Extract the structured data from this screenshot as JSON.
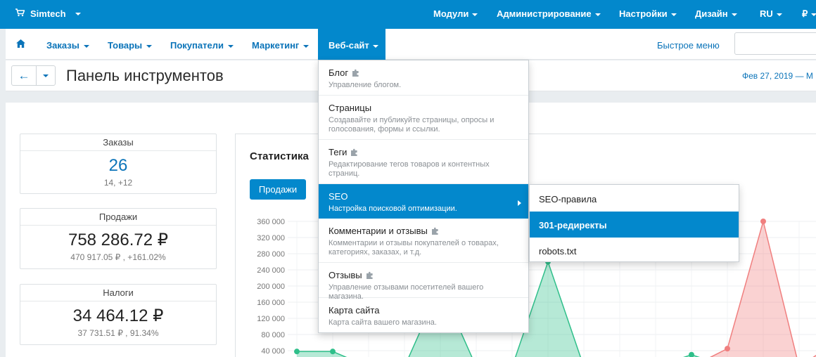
{
  "topbar": {
    "store_name": "Simtech",
    "cart_icon": "cart-icon",
    "menus": [
      "Модули",
      "Администрирование",
      "Настройки",
      "Дизайн",
      "RU",
      "₽"
    ]
  },
  "nav": {
    "home_icon": "home-icon",
    "items": [
      "Заказы",
      "Товары",
      "Покупатели",
      "Маркетинг"
    ],
    "active": "Веб-сайт",
    "quick_menu": "Быстрое меню",
    "search_placeholder": ""
  },
  "page": {
    "title": "Панель инструментов",
    "date_range": "Фев 27, 2019 — М"
  },
  "cards": [
    {
      "label": "Заказы",
      "value": "26",
      "sub": "14, +12"
    },
    {
      "label": "Продажи",
      "value": "758 286.72 ₽",
      "sub": "470 917.05 ₽ , +161.02%"
    },
    {
      "label": "Налоги",
      "value": "34 464.12 ₽",
      "sub": "37 731.51 ₽ , 91.34%"
    }
  ],
  "stats": {
    "title": "Статистика",
    "button": "Продажи"
  },
  "dropdown": {
    "items": [
      {
        "title": "Блог",
        "desc": "Управление блогом.",
        "addon": true
      },
      {
        "title": "Страницы",
        "desc": "Создавайте и публикуйте страницы, опросы и голосования, формы и ссылки.",
        "addon": false
      },
      {
        "title": "Теги",
        "desc": "Редактирование тегов товаров и контентных страниц.",
        "addon": true
      },
      {
        "title": "SEO",
        "desc": "Настройка поисковой оптимизации.",
        "addon": false
      },
      {
        "title": "Комментарии и отзывы",
        "desc": "Комментарии и отзывы покупателей о товарах, категориях, заказах, и т.д.",
        "addon": true
      },
      {
        "title": "Отзывы",
        "desc": "Управление отзывами посетителей вашего магазина.",
        "addon": true
      },
      {
        "title": "Карта сайта",
        "desc": "Карта сайта вашего магазина.",
        "addon": false
      }
    ]
  },
  "submenu": {
    "items": [
      "SEO-правила",
      "301-редиректы",
      "robots.txt"
    ]
  },
  "chart_data": {
    "type": "area",
    "yticks": [
      "360 000",
      "320 000",
      "280 000",
      "240 000",
      "200 000",
      "160 000",
      "120 000",
      "80 000",
      "40 000"
    ],
    "ylim": [
      0,
      380000
    ],
    "series": [
      {
        "color": "#2fbf8a",
        "x": [
          0,
          1,
          2,
          3,
          4,
          5,
          6,
          7,
          8,
          9,
          10,
          11,
          12,
          13
        ],
        "values": [
          38000,
          38000,
          0,
          0,
          200000,
          0,
          0,
          260000,
          0,
          0,
          0,
          30000,
          0,
          0
        ]
      },
      {
        "color": "#f07f7f",
        "x": [
          11,
          12,
          13,
          14,
          15,
          16
        ],
        "values": [
          0,
          45000,
          360000,
          0,
          60000,
          0
        ]
      }
    ],
    "grid": true
  }
}
